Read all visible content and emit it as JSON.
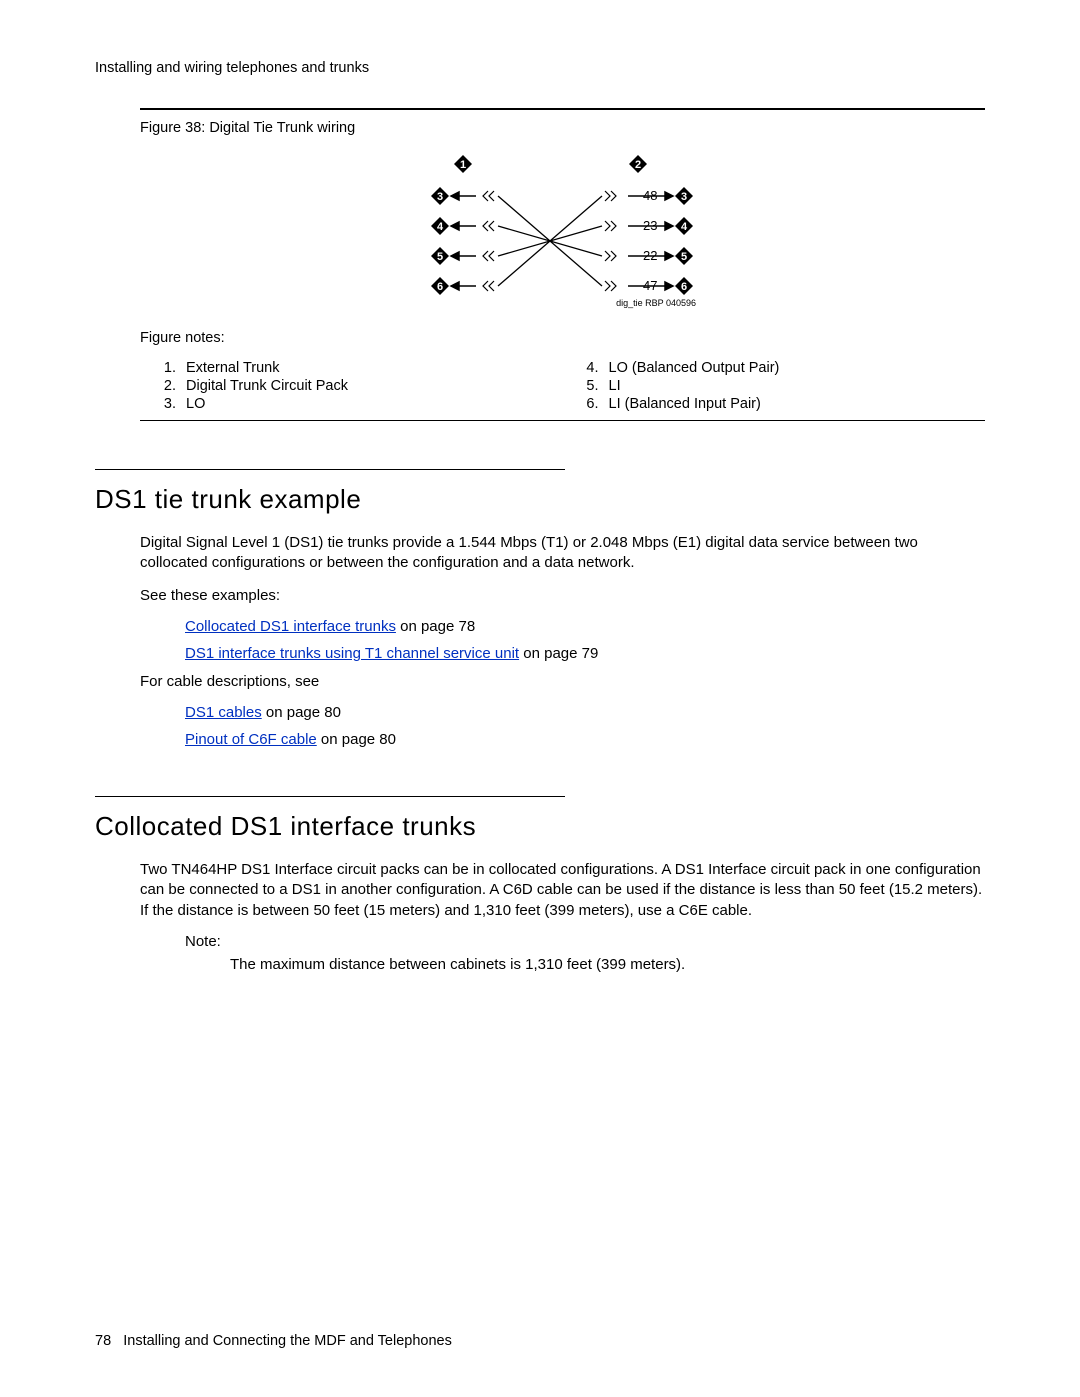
{
  "running_head": "Installing and wiring telephones and trunks",
  "figure": {
    "caption": "Figure 38: Digital Tie Trunk wiring",
    "notes_label": "Figure notes:",
    "notes_left": [
      "External Trunk",
      "Digital Trunk Circuit Pack",
      "LO"
    ],
    "notes_right": [
      "LO (Balanced Output Pair)",
      "LI",
      "LI (Balanced Input Pair)"
    ],
    "diagram_label": "dig_tie RBP 040596",
    "right_values": [
      "48",
      "23",
      "22",
      "47"
    ]
  },
  "section1": {
    "title": "DS1 tie trunk example",
    "para1": "Digital Signal Level 1 (DS1) tie trunks provide a 1.544 Mbps (T1) or 2.048 Mbps (E1) digital data service between two collocated configurations or between the configuration and a data network.",
    "para2": "See these examples:",
    "link1_text": "Collocated DS1 interface trunks",
    "link1_suffix": " on page 78",
    "link2_text": "DS1 interface trunks using T1 channel service unit",
    "link2_suffix": " on page 79",
    "para3": "For cable descriptions, see",
    "link3_text": "DS1 cables",
    "link3_suffix": " on page 80",
    "link4_text": "Pinout of C6F cable",
    "link4_suffix": " on page 80"
  },
  "section2": {
    "title": "Collocated DS1 interface trunks",
    "para1": "Two TN464HP DS1 Interface circuit packs can be in collocated configurations. A DS1 Interface circuit pack in one configuration can be connected to a DS1 in another configuration. A C6D cable can be used if the distance is less than 50 feet (15.2 meters). If the distance is between 50 feet (15 meters) and 1,310 feet (399 meters), use a C6E cable.",
    "note_label": "Note:",
    "note_body": "The maximum distance between cabinets is 1,310 feet (399 meters)."
  },
  "footer": {
    "page": "78",
    "text": "Installing and Connecting the MDF and Telephones"
  },
  "chart_data": {
    "type": "diagram",
    "description": "Digital Tie Trunk wiring diagram with two endpoints (1=External Trunk, 2=Digital Trunk Circuit Pack) and four wire pairs cross-connected.",
    "left_pins": [
      3,
      4,
      5,
      6
    ],
    "right_pins": [
      3,
      4,
      5,
      6
    ],
    "right_wire_numbers": [
      48,
      23,
      22,
      47
    ],
    "connections": [
      {
        "from_left_pin": 3,
        "to_right_pin": 6,
        "to_wire": 47
      },
      {
        "from_left_pin": 4,
        "to_right_pin": 5,
        "to_wire": 22
      },
      {
        "from_left_pin": 5,
        "to_right_pin": 4,
        "to_wire": 23
      },
      {
        "from_left_pin": 6,
        "to_right_pin": 3,
        "to_wire": 48
      }
    ]
  }
}
